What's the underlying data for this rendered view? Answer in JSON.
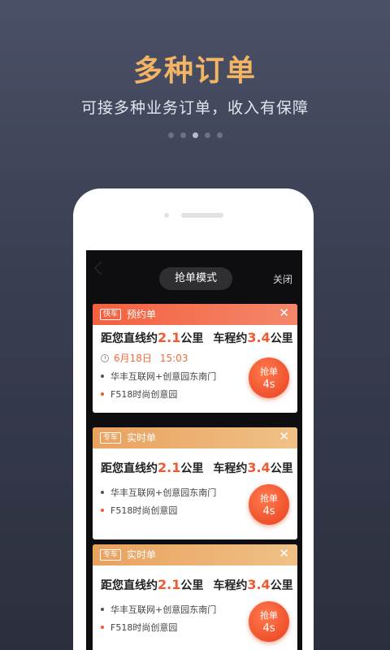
{
  "headline": "多种订单",
  "subline": "可接多种业务订单，收入有保障",
  "carousel": {
    "count": 5,
    "active": 2
  },
  "screen": {
    "mode_button": "抢单模式",
    "close_label": "关闭",
    "cards": [
      {
        "tag": "快车",
        "type": "预约单",
        "dist_prefix": "距您直线约",
        "dist_val": "2.1",
        "unit1": "公里",
        "route_prefix": "车程约",
        "route_val": "3.4",
        "unit2": "公里",
        "date": "6月18日",
        "time": "15:03",
        "from": "华丰互联网+创意园东南门",
        "to": "F518时尚创意园",
        "grab_label": "抢单",
        "grab_seconds": "4s",
        "close": "✕"
      },
      {
        "tag": "专车",
        "type": "实时单",
        "dist_prefix": "距您直线约",
        "dist_val": "2.1",
        "unit1": "公里",
        "route_prefix": "车程约",
        "route_val": "3.4",
        "unit2": "公里",
        "from": "华丰互联网+创意园东南门",
        "to": "F518时尚创意园",
        "grab_label": "抢单",
        "grab_seconds": "4s",
        "close": "✕"
      },
      {
        "tag": "专车",
        "type": "实时单",
        "dist_prefix": "距您直线约",
        "dist_val": "2.1",
        "unit1": "公里",
        "route_prefix": "车程约",
        "route_val": "3.4",
        "unit2": "公里",
        "from": "华丰互联网+创意园东南门",
        "to": "F518时尚创意园",
        "grab_label": "抢单",
        "grab_seconds": "4s",
        "close": "✕"
      }
    ]
  },
  "colors": {
    "accent": "#f3b463",
    "order_red": "#f05a33"
  }
}
